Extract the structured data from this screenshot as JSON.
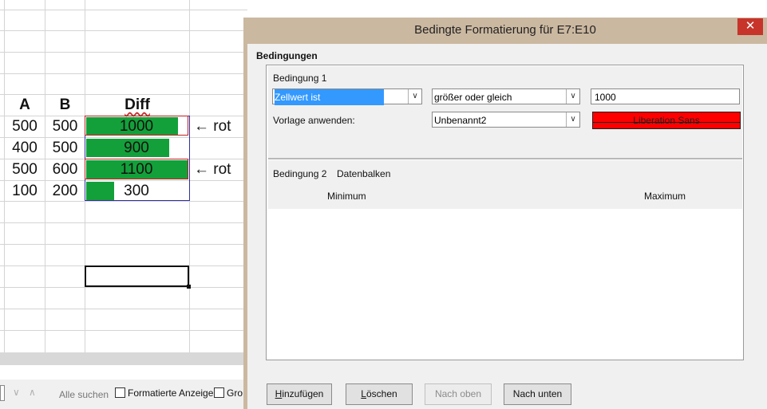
{
  "sheet": {
    "headers": [
      "A",
      "B",
      "Diff"
    ],
    "rows": [
      {
        "a": "500",
        "b": "500",
        "diff": "1000",
        "diff_value": 1000,
        "note": "← rot"
      },
      {
        "a": "400",
        "b": "500",
        "diff": "900",
        "diff_value": 900,
        "note": ""
      },
      {
        "a": "500",
        "b": "600",
        "diff": "1100",
        "diff_value": 1100,
        "note": "← rot"
      },
      {
        "a": "100",
        "b": "200",
        "diff": "300",
        "diff_value": 300,
        "note": ""
      }
    ],
    "bar_color": "#13a03a"
  },
  "findbar": {
    "search_all": "Alle suchen",
    "formatted_display": "Formatierte Anzeige",
    "case_partial": "Gro"
  },
  "dialog": {
    "title": "Bedingte Formatierung für E7:E10",
    "close": "✕",
    "section_label": "Bedingungen",
    "condition1": {
      "label": "Bedingung 1",
      "type": "Zellwert ist",
      "operator": "größer oder gleich",
      "value": "1000",
      "style_label": "Vorlage anwenden:",
      "style": "Unbenannt2",
      "preview": "Liberation Sans",
      "preview_color": "#ff0000"
    },
    "condition2": {
      "label": "Bedingung 2",
      "type": "Datenbalken",
      "min": "Minimum",
      "max": "Maximum"
    },
    "buttons": {
      "add": "Hinzufügen",
      "delete": "Löschen",
      "up": "Nach oben",
      "down": "Nach unten"
    }
  }
}
